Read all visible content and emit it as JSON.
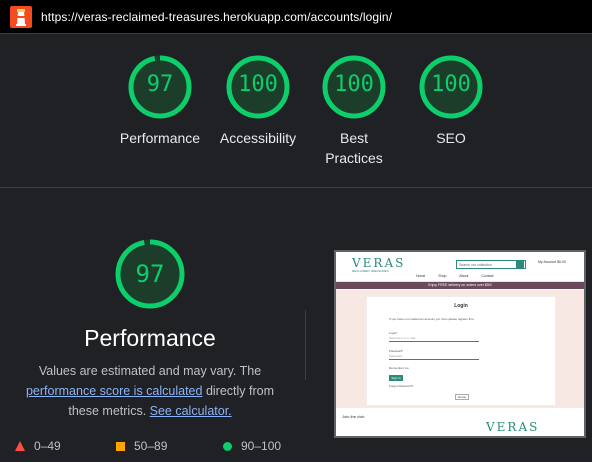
{
  "url_bar": {
    "url": "https://veras-reclaimed-treasures.herokuapp.com/accounts/login/"
  },
  "categories": [
    {
      "score": 97,
      "label": "Performance"
    },
    {
      "score": 100,
      "label": "Accessibility"
    },
    {
      "score": 100,
      "label": "Best Practices"
    },
    {
      "score": 100,
      "label": "SEO"
    }
  ],
  "performance": {
    "score": "97",
    "title": "Performance",
    "desc_part1": "Values are estimated and may vary. The ",
    "desc_link1": "performance score is calculated",
    "desc_part2": " directly from these metrics. ",
    "desc_link2": "See calculator."
  },
  "legend": {
    "fail": "0–49",
    "average": "50–89",
    "pass": "90–100"
  },
  "thumbnail": {
    "logo": "VERAS",
    "logo_sub": "RECLAIMED TREASURES",
    "search_placeholder": "Search our collection",
    "account_icons": "My Account   $0.00",
    "nav": "Home Shop About Contact",
    "banner": "Enjoy FREE delivery on orders over $50!",
    "card_title": "Login",
    "card_intro": "If you have not created an account yet, then please register first.",
    "login_label": "Login*",
    "login_placeholder": "Username or e-mail",
    "password_label": "Password*",
    "password_placeholder": "Password",
    "remember_me": "Remember me",
    "signin_button": "Sign In",
    "forgot": "Forgot Password?",
    "home_button": "Home",
    "footer_join": "Join the club",
    "footer_logo": "VERAS"
  },
  "colors": {
    "pass": "#0cce6b",
    "average": "#ffa400",
    "fail": "#ff4e42"
  }
}
